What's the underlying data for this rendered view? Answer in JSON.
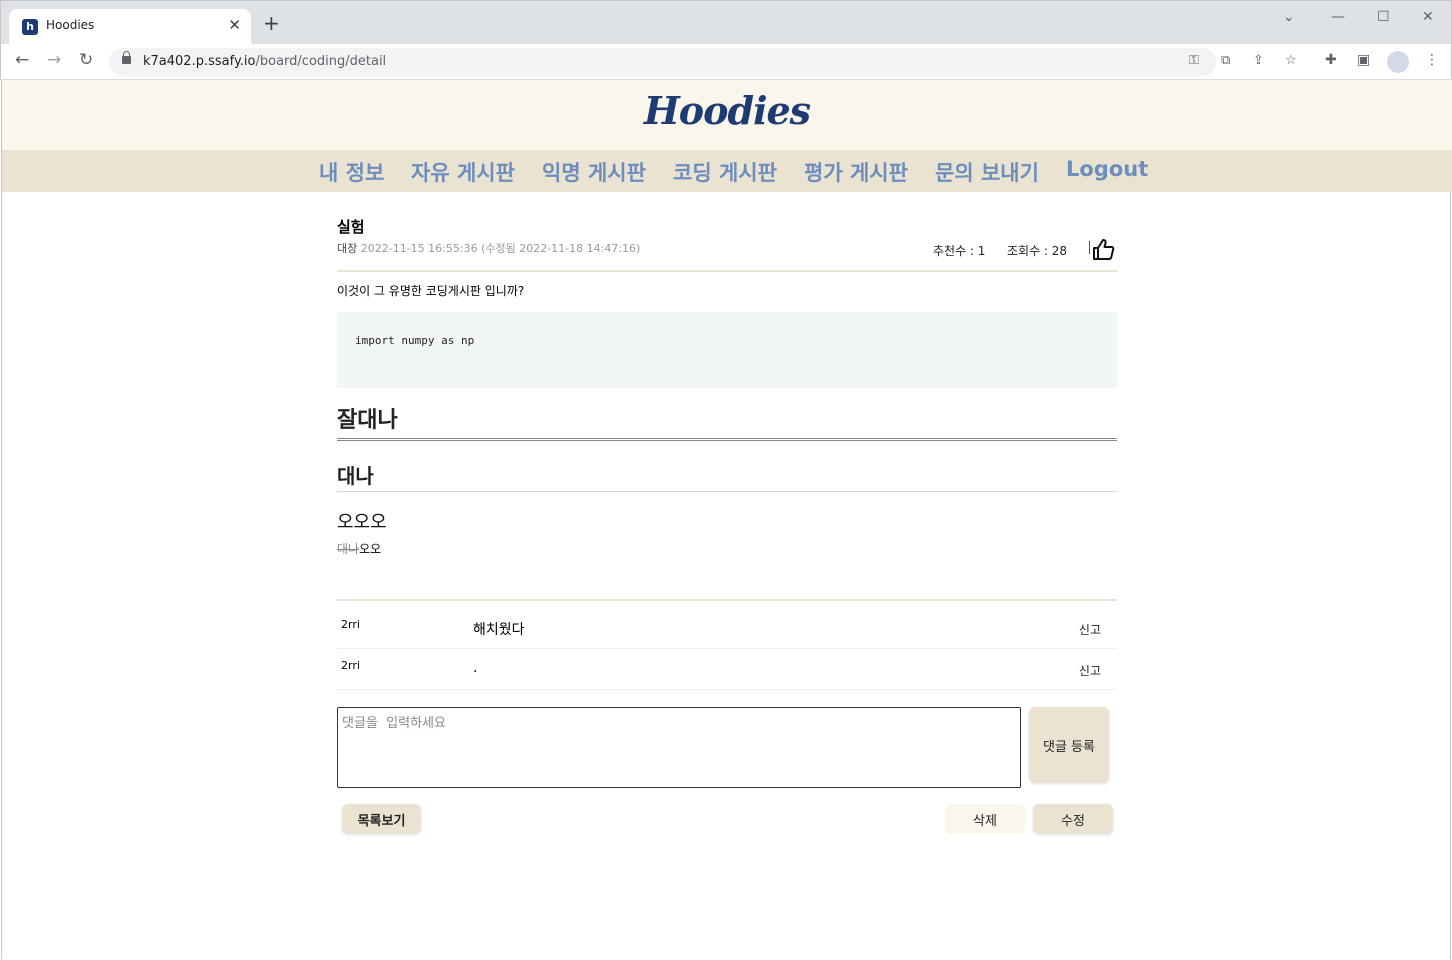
{
  "browser": {
    "tab_title": "Hoodies",
    "favicon_letter": "h",
    "url_host": "k7a402.p.ssafy.io",
    "url_path": "/board/coding/detail"
  },
  "site": {
    "logo": "Hoodies",
    "nav": [
      "내 정보",
      "자유 게시판",
      "익명 게시판",
      "코딩 게시판",
      "평가 게시판",
      "문의 보내기",
      "Logout"
    ]
  },
  "post": {
    "title": "실험",
    "author": "대장",
    "date_info": "2022-11-15 16:55:36 (수정됨 2022-11-18 14:47:16)",
    "likes_text": "추천수 : 1",
    "views_text": "조회수 : 28",
    "body_text": "이것이 그 유명한 코딩게시판 입니까?",
    "code": "import numpy as np",
    "heading1": "잘대나",
    "heading2": "대나",
    "heading3": "오오오",
    "strike_text": "대나",
    "after_strike": "오오"
  },
  "comments": [
    {
      "user": "2rri",
      "text": "해치웠다",
      "report": "신고"
    },
    {
      "user": "2rri",
      "text": ".",
      "report": "신고"
    }
  ],
  "comment_form": {
    "placeholder": "댓글을  입력하세요",
    "submit_label": "댓글 등록"
  },
  "actions": {
    "list_label": "목록보기",
    "delete_label": "삭제",
    "edit_label": "수정"
  },
  "colors": {
    "header_bg": "#faf6ec",
    "nav_bg": "#ebe3d2",
    "nav_text": "#6c8ebf",
    "logo": "#1f3b73"
  }
}
